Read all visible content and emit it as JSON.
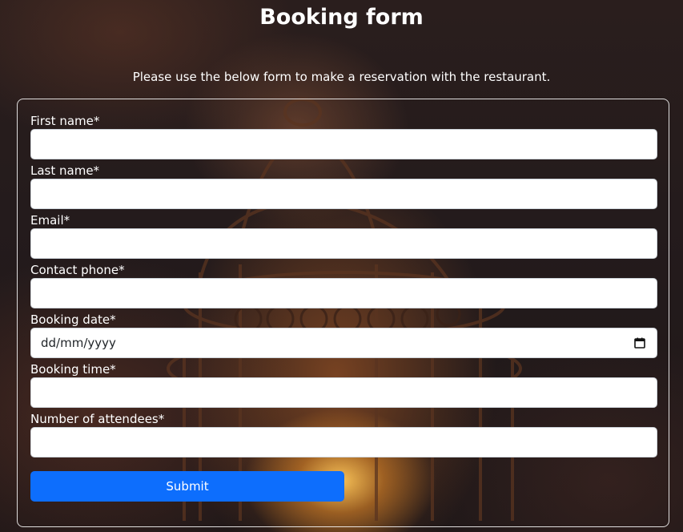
{
  "header": {
    "title": "Booking form",
    "subtitle": "Please use the below form to make a reservation with the restaurant."
  },
  "form": {
    "fields": [
      {
        "label": "First name*",
        "value": ""
      },
      {
        "label": "Last name*",
        "value": ""
      },
      {
        "label": "Email*",
        "value": ""
      },
      {
        "label": "Contact phone*",
        "value": ""
      },
      {
        "label": "Booking date*",
        "value": "dd/mm/yyyy"
      },
      {
        "label": "Booking time*",
        "value": ""
      },
      {
        "label": "Number of attendees*",
        "value": ""
      }
    ],
    "submit_label": "Submit"
  },
  "colors": {
    "accent": "#0d6efd",
    "text": "#ffffff"
  },
  "icons": {
    "date_picker": "calendar-icon"
  }
}
